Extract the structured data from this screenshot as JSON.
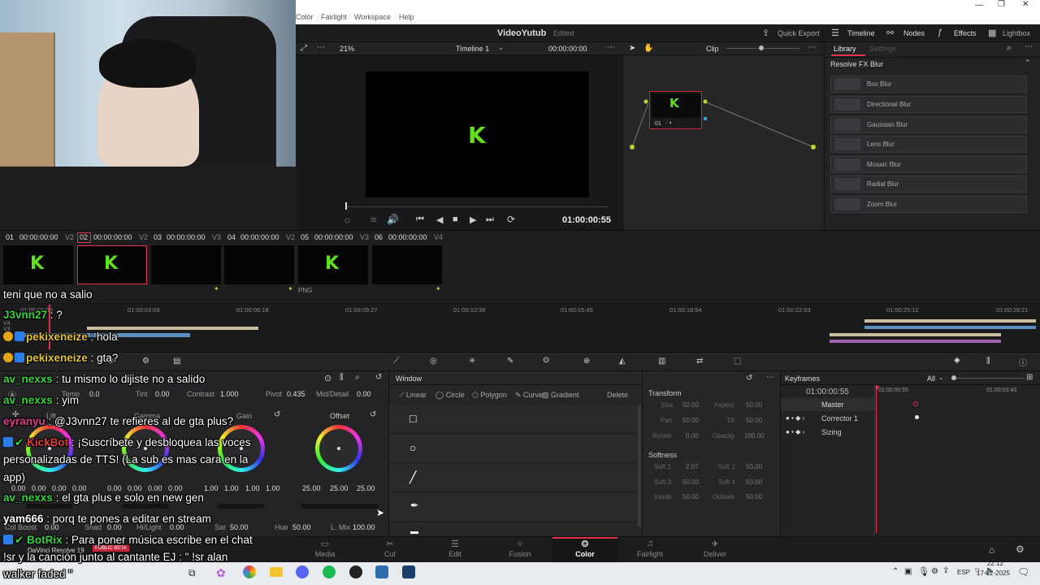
{
  "menu": [
    "Color",
    "Fairlight",
    "Workspace",
    "Help"
  ],
  "app": {
    "project": "VideoYutub",
    "status": "Edited",
    "quick_export": "Quick Export",
    "timeline_btn": "Timeline",
    "nodes_btn": "Nodes",
    "effects_btn": "Effects",
    "lightbox_btn": "Lightbox"
  },
  "viewer": {
    "zoom": "21%",
    "timeline_name": "Timeline 1",
    "timecode": "00:00:00:00",
    "clip_mode": "Clip",
    "playhead_tc": "01:00:00:55"
  },
  "node": {
    "label": "01"
  },
  "library": {
    "tab_library": "Library",
    "tab_settings": "Settings",
    "section": "Resolve FX Blur",
    "items": [
      "Box Blur",
      "Directional Blur",
      "Gaussian Blur",
      "Lens Blur",
      "Mosaic Blur",
      "Radial Blur",
      "Zoom Blur"
    ]
  },
  "clips": [
    {
      "num": "01",
      "tc": "00:00:00:00",
      "track": "V2",
      "logo": "K"
    },
    {
      "num": "02",
      "tc": "00:00:00:00",
      "track": "V2",
      "logo": "K"
    },
    {
      "num": "03",
      "tc": "00:00:00:00",
      "track": "V3",
      "logo": ""
    },
    {
      "num": "04",
      "tc": "00:00:00:00",
      "track": "V2",
      "logo": ""
    },
    {
      "num": "05",
      "tc": "00:00:00:00",
      "track": "V3",
      "logo": "K"
    },
    {
      "num": "06",
      "tc": "00:00:00:00",
      "track": "V4",
      "logo": ""
    }
  ],
  "clip_tags": [
    "PNG"
  ],
  "ruler": [
    "01:00:03:09",
    "01:00:06:18",
    "01:00:09:27",
    "01:00:12:36",
    "01:00:15:45",
    "01:00:18:54",
    "01:00:22:03",
    "01:00:25:12",
    "01:00:28:21"
  ],
  "ruler_first": "01:00:00:00",
  "tracks": [
    "V4",
    "V3"
  ],
  "primaries": {
    "temp_label": "Temp",
    "temp": "0.0",
    "tint_label": "Tint",
    "tint": "0.00",
    "contrast_label": "Contrast",
    "contrast": "1.000",
    "pivot_label": "Pivot",
    "pivot": "0.435",
    "middetail_label": "Mid/Detail",
    "middetail": "0.00",
    "wheels": [
      {
        "name": "Lift",
        "vals": [
          "0.00",
          "0.00",
          "0.00",
          "0.00"
        ]
      },
      {
        "name": "Gamma",
        "vals": [
          "0.00",
          "0.00",
          "0.00",
          "0.00"
        ]
      },
      {
        "name": "Gain",
        "vals": [
          "1.00",
          "1.00",
          "1.00",
          "1.00"
        ]
      },
      {
        "name": "Offset",
        "vals": [
          "25.00",
          "25.00",
          "25.00"
        ]
      }
    ],
    "colboost_label": "Col Boost",
    "colboost": "0.00",
    "shad_label": "Shad",
    "shad": "0.00",
    "hilight_label": "Hi/Light",
    "hilight": "0.00",
    "sat_label": "Sat",
    "sat": "50.00",
    "hue_label": "Hue",
    "hue": "50.00",
    "lmix_label": "L. Mix",
    "lmix": "100.00"
  },
  "window": {
    "title": "Window",
    "tools": [
      "Linear",
      "Circle",
      "Polygon",
      "Curve",
      "Gradient"
    ],
    "delete": "Delete"
  },
  "transform": {
    "title": "Transform",
    "rows": [
      [
        "Size",
        "50.00",
        "Aspect",
        "50.00"
      ],
      [
        "Pan",
        "50.00",
        "Tilt",
        "50.00"
      ],
      [
        "Rotate",
        "0.00",
        "Opacity",
        "100.00"
      ]
    ],
    "softness_title": "Softness",
    "soft_rows": [
      [
        "Soft 1",
        "2.07",
        "Soft 2",
        "50.00"
      ],
      [
        "Soft 3",
        "50.00",
        "Soft 4",
        "50.00"
      ],
      [
        "Inside",
        "50.00",
        "Outside",
        "50.00"
      ]
    ]
  },
  "keyframes": {
    "title": "Keyframes",
    "filter": "All",
    "tc": "01:00:00:55",
    "tc_a": "01:00:00:55",
    "tc_b": "01:00:03:43",
    "rows": [
      "Master",
      "Corrector 1",
      "Sizing"
    ]
  },
  "pages": [
    "Media",
    "Cut",
    "Edit",
    "Fusion",
    "Color",
    "Fairlight",
    "Deliver"
  ],
  "active_page": "Color",
  "resolve_label": "DaVinci Resolve 19",
  "beta_label": "PUBLIC BETA",
  "taskbar": {
    "lang": "ESP",
    "time": "22:12",
    "date": "17-12-2025"
  },
  "chat": [
    {
      "user": "",
      "text": "teni que no a salio",
      "color": "#ffffff"
    },
    {
      "user": "J3vnn27",
      "text": " : ?",
      "color": "#37d43a"
    },
    {
      "user": "pekixeneize",
      "text": " : hola",
      "color": "#e6c229",
      "badge": "gold"
    },
    {
      "user": "pekixeneize",
      "text": " : gta?",
      "color": "#e6c229",
      "badge": "gold"
    },
    {
      "user": "av_nexxs",
      "text": " : tu mismo lo dijiste no a salido",
      "color": "#37d43a"
    },
    {
      "user": "av_nexxs",
      "text": " : yim",
      "color": "#37d43a"
    },
    {
      "user": "eyranyu",
      "text": " : @J3vnn27 te refieres al de gta plus?",
      "color": "#e03a8c"
    },
    {
      "user": "KickBot",
      "text": " : ¡Suscríbete y desbloquea las voces",
      "color": "#e33b3b",
      "badge": "blue"
    },
    {
      "user": "",
      "text": "personalizadas de TTS! (La sub es mas cara en la",
      "color": "#ffffff"
    },
    {
      "user": "",
      "text": "app)",
      "color": "#ffffff"
    },
    {
      "user": "av_nexxs",
      "text": " : el gta plus e solo en new gen",
      "color": "#37d43a"
    },
    {
      "user": "yam666",
      "text": " : porq te pones a editar en stream",
      "color": "#ffffff"
    },
    {
      "user": "BotRix",
      "text": " : Para poner música escribe en el chat",
      "color": "#37d43a",
      "badge": "blue"
    },
    {
      "user": "",
      "text": "!sr y la canción junto al cantante EJ : \" !sr alan",
      "color": "#ffffff"
    },
    {
      "user": "",
      "text": "walker faded \"",
      "color": "#ffffff"
    }
  ],
  "colors": {
    "accent_red": "#e0304a",
    "kick_green": "#5fe01b"
  }
}
